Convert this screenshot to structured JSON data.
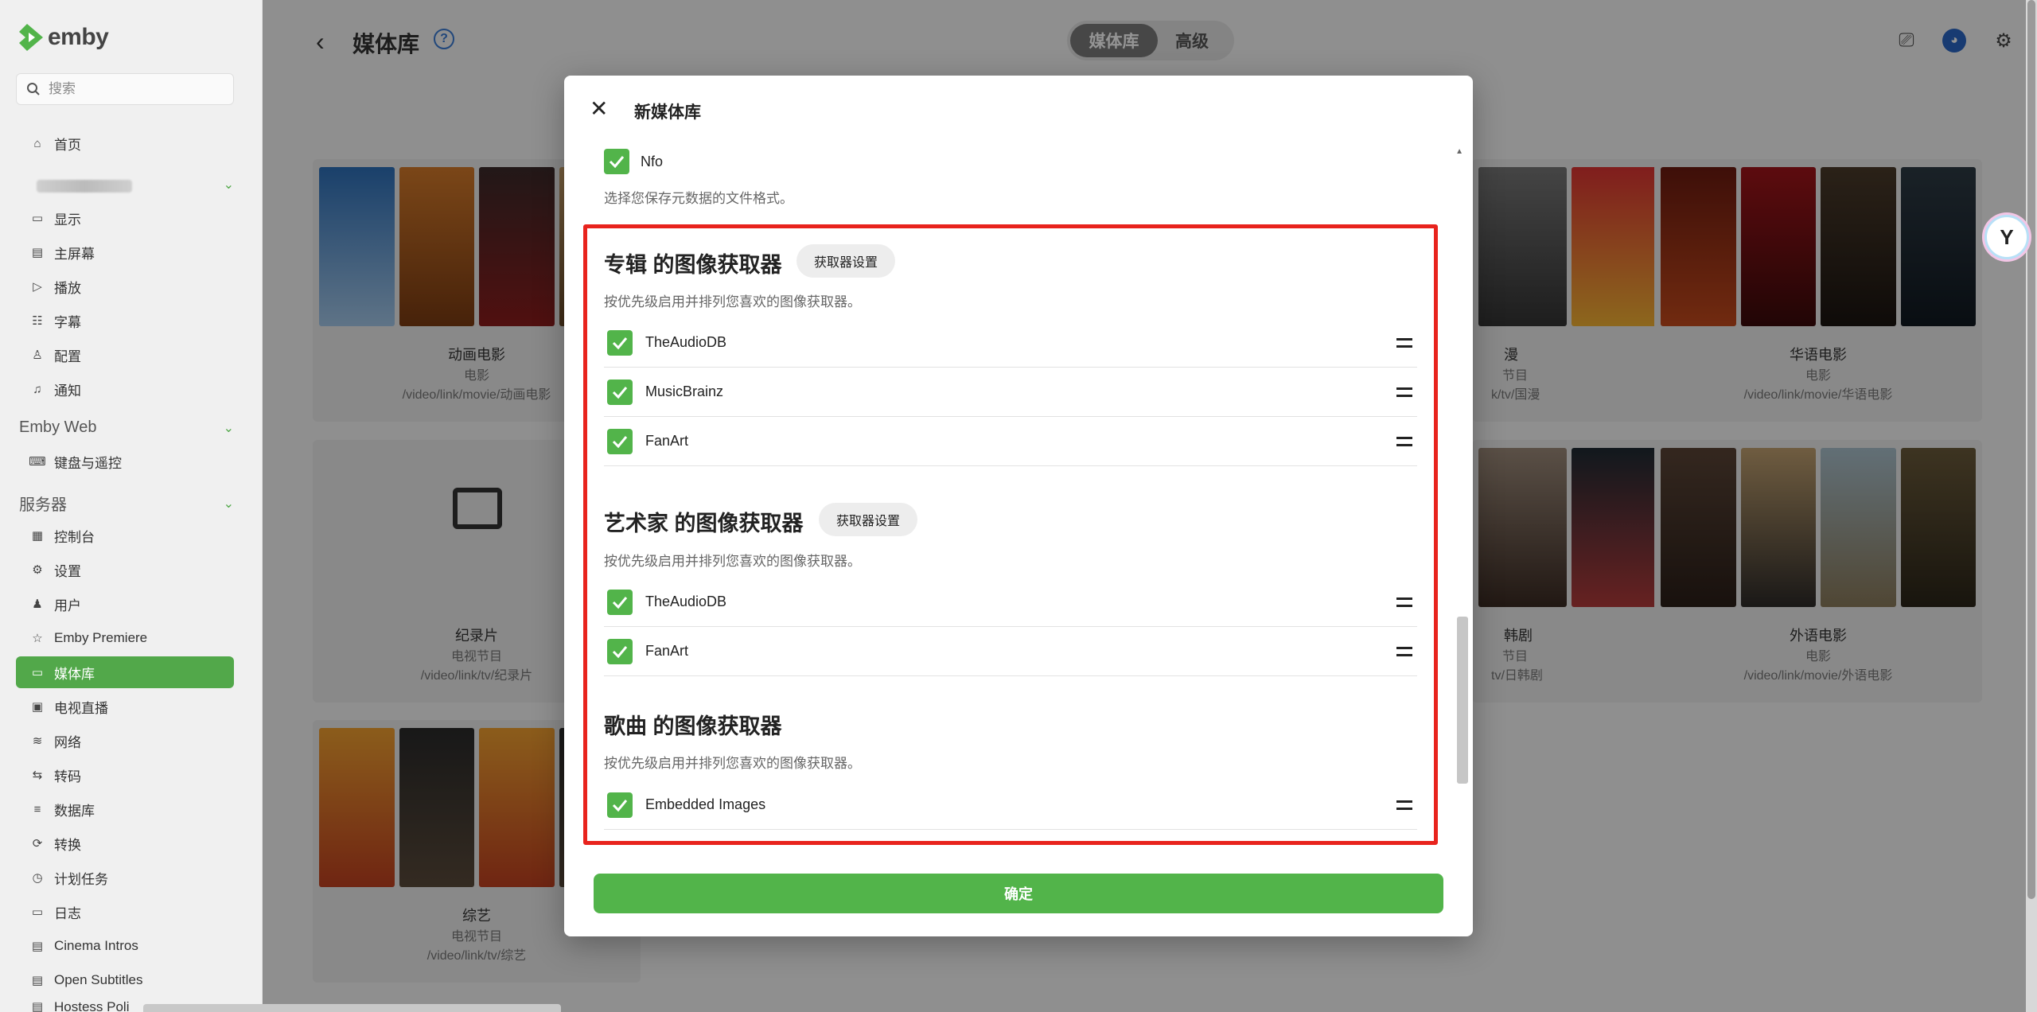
{
  "app": {
    "name": "emby"
  },
  "search": {
    "placeholder": "搜索"
  },
  "sidebar": {
    "home": "首页",
    "user_section": [
      {
        "label": "显示",
        "icon": "monitor-icon"
      },
      {
        "label": "主屏幕",
        "icon": "home-screen-icon"
      },
      {
        "label": "播放",
        "icon": "play-icon"
      },
      {
        "label": "字幕",
        "icon": "subtitles-icon"
      },
      {
        "label": "配置",
        "icon": "profile-icon"
      },
      {
        "label": "通知",
        "icon": "bell-icon"
      }
    ],
    "emby_web_title": "Emby Web",
    "emby_web_items": [
      {
        "label": "键盘与遥控",
        "icon": "keyboard-icon"
      }
    ],
    "server_title": "服务器",
    "server_items": [
      {
        "label": "控制台",
        "icon": "dashboard-icon"
      },
      {
        "label": "设置",
        "icon": "gear-icon"
      },
      {
        "label": "用户",
        "icon": "users-icon"
      },
      {
        "label": "Emby Premiere",
        "icon": "star-icon"
      },
      {
        "label": "媒体库",
        "icon": "folder-icon",
        "active": true
      },
      {
        "label": "电视直播",
        "icon": "tv-icon"
      },
      {
        "label": "网络",
        "icon": "wifi-icon"
      },
      {
        "label": "转码",
        "icon": "transcode-icon"
      },
      {
        "label": "数据库",
        "icon": "database-icon"
      },
      {
        "label": "转换",
        "icon": "convert-icon"
      },
      {
        "label": "计划任务",
        "icon": "clock-icon"
      },
      {
        "label": "日志",
        "icon": "log-icon"
      },
      {
        "label": "Cinema Intros",
        "icon": "cinema-icon"
      },
      {
        "label": "Open Subtitles",
        "icon": "subtitles-icon"
      }
    ],
    "partial_item": "Hostess Poli"
  },
  "header": {
    "title": "媒体库",
    "tabs": [
      "媒体库",
      "高级"
    ]
  },
  "libraries": [
    {
      "name": "动画电影",
      "type": "电影",
      "path": "/video/link/movie/动画电影"
    },
    {
      "name": "漫",
      "type": "节目",
      "path": "k/tv/国漫"
    },
    {
      "name": "华语电影",
      "type": "电影",
      "path": "/video/link/movie/华语电影"
    },
    {
      "name": "纪录片",
      "type": "电视节目",
      "path": "/video/link/tv/纪录片"
    },
    {
      "name": "韩剧",
      "type": "节目",
      "path": "tv/日韩剧"
    },
    {
      "name": "外语电影",
      "type": "电影",
      "path": "/video/link/movie/外语电影"
    },
    {
      "name": "综艺",
      "type": "电视节目",
      "path": "/video/link/tv/综艺"
    }
  ],
  "modal": {
    "title": "新媒体库",
    "nfo_label": "Nfo",
    "metadata_help": "选择您保存元数据的文件格式。",
    "album_fetchers": {
      "title": "专辑 的图像获取器",
      "settings_btn": "获取器设置",
      "help": "按优先级启用并排列您喜欢的图像获取器。",
      "items": [
        "TheAudioDB",
        "MusicBrainz",
        "FanArt"
      ]
    },
    "artist_fetchers": {
      "title": "艺术家 的图像获取器",
      "settings_btn": "获取器设置",
      "help": "按优先级启用并排列您喜欢的图像获取器。",
      "items": [
        "TheAudioDB",
        "FanArt"
      ]
    },
    "song_fetchers": {
      "title": "歌曲 的图像获取器",
      "help": "按优先级启用并排列您喜欢的图像获取器。",
      "items": [
        "Embedded Images"
      ]
    },
    "confirm": "确定"
  },
  "colors": {
    "accent": "#52b44a",
    "highlight_box": "#e8231d"
  }
}
